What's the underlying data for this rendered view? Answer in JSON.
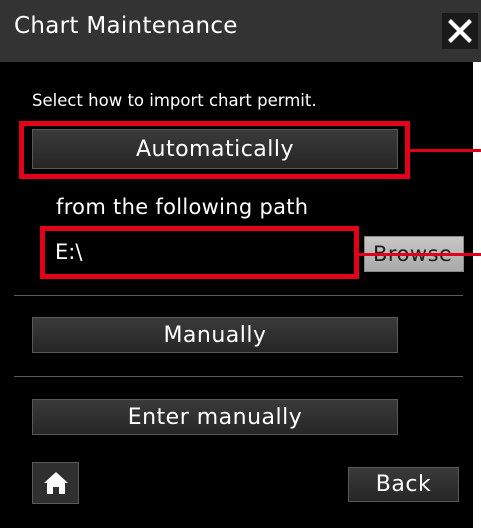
{
  "dialog": {
    "title": "Chart Maintenance",
    "instruction": "Select how to import chart permit.",
    "auto_label": "Automatically",
    "path_caption": "from the following path",
    "path_value": "E:\\",
    "browse_label": "Browse",
    "manual_label": "Manually",
    "enter_manual_label": "Enter manually",
    "back_label": "Back"
  },
  "icons": {
    "close": "close-icon",
    "home": "home-icon"
  },
  "colors": {
    "title_bar": "#333333",
    "panel": "#000000",
    "highlight": "#e2001a",
    "browse_button": "#bdbdbd"
  }
}
